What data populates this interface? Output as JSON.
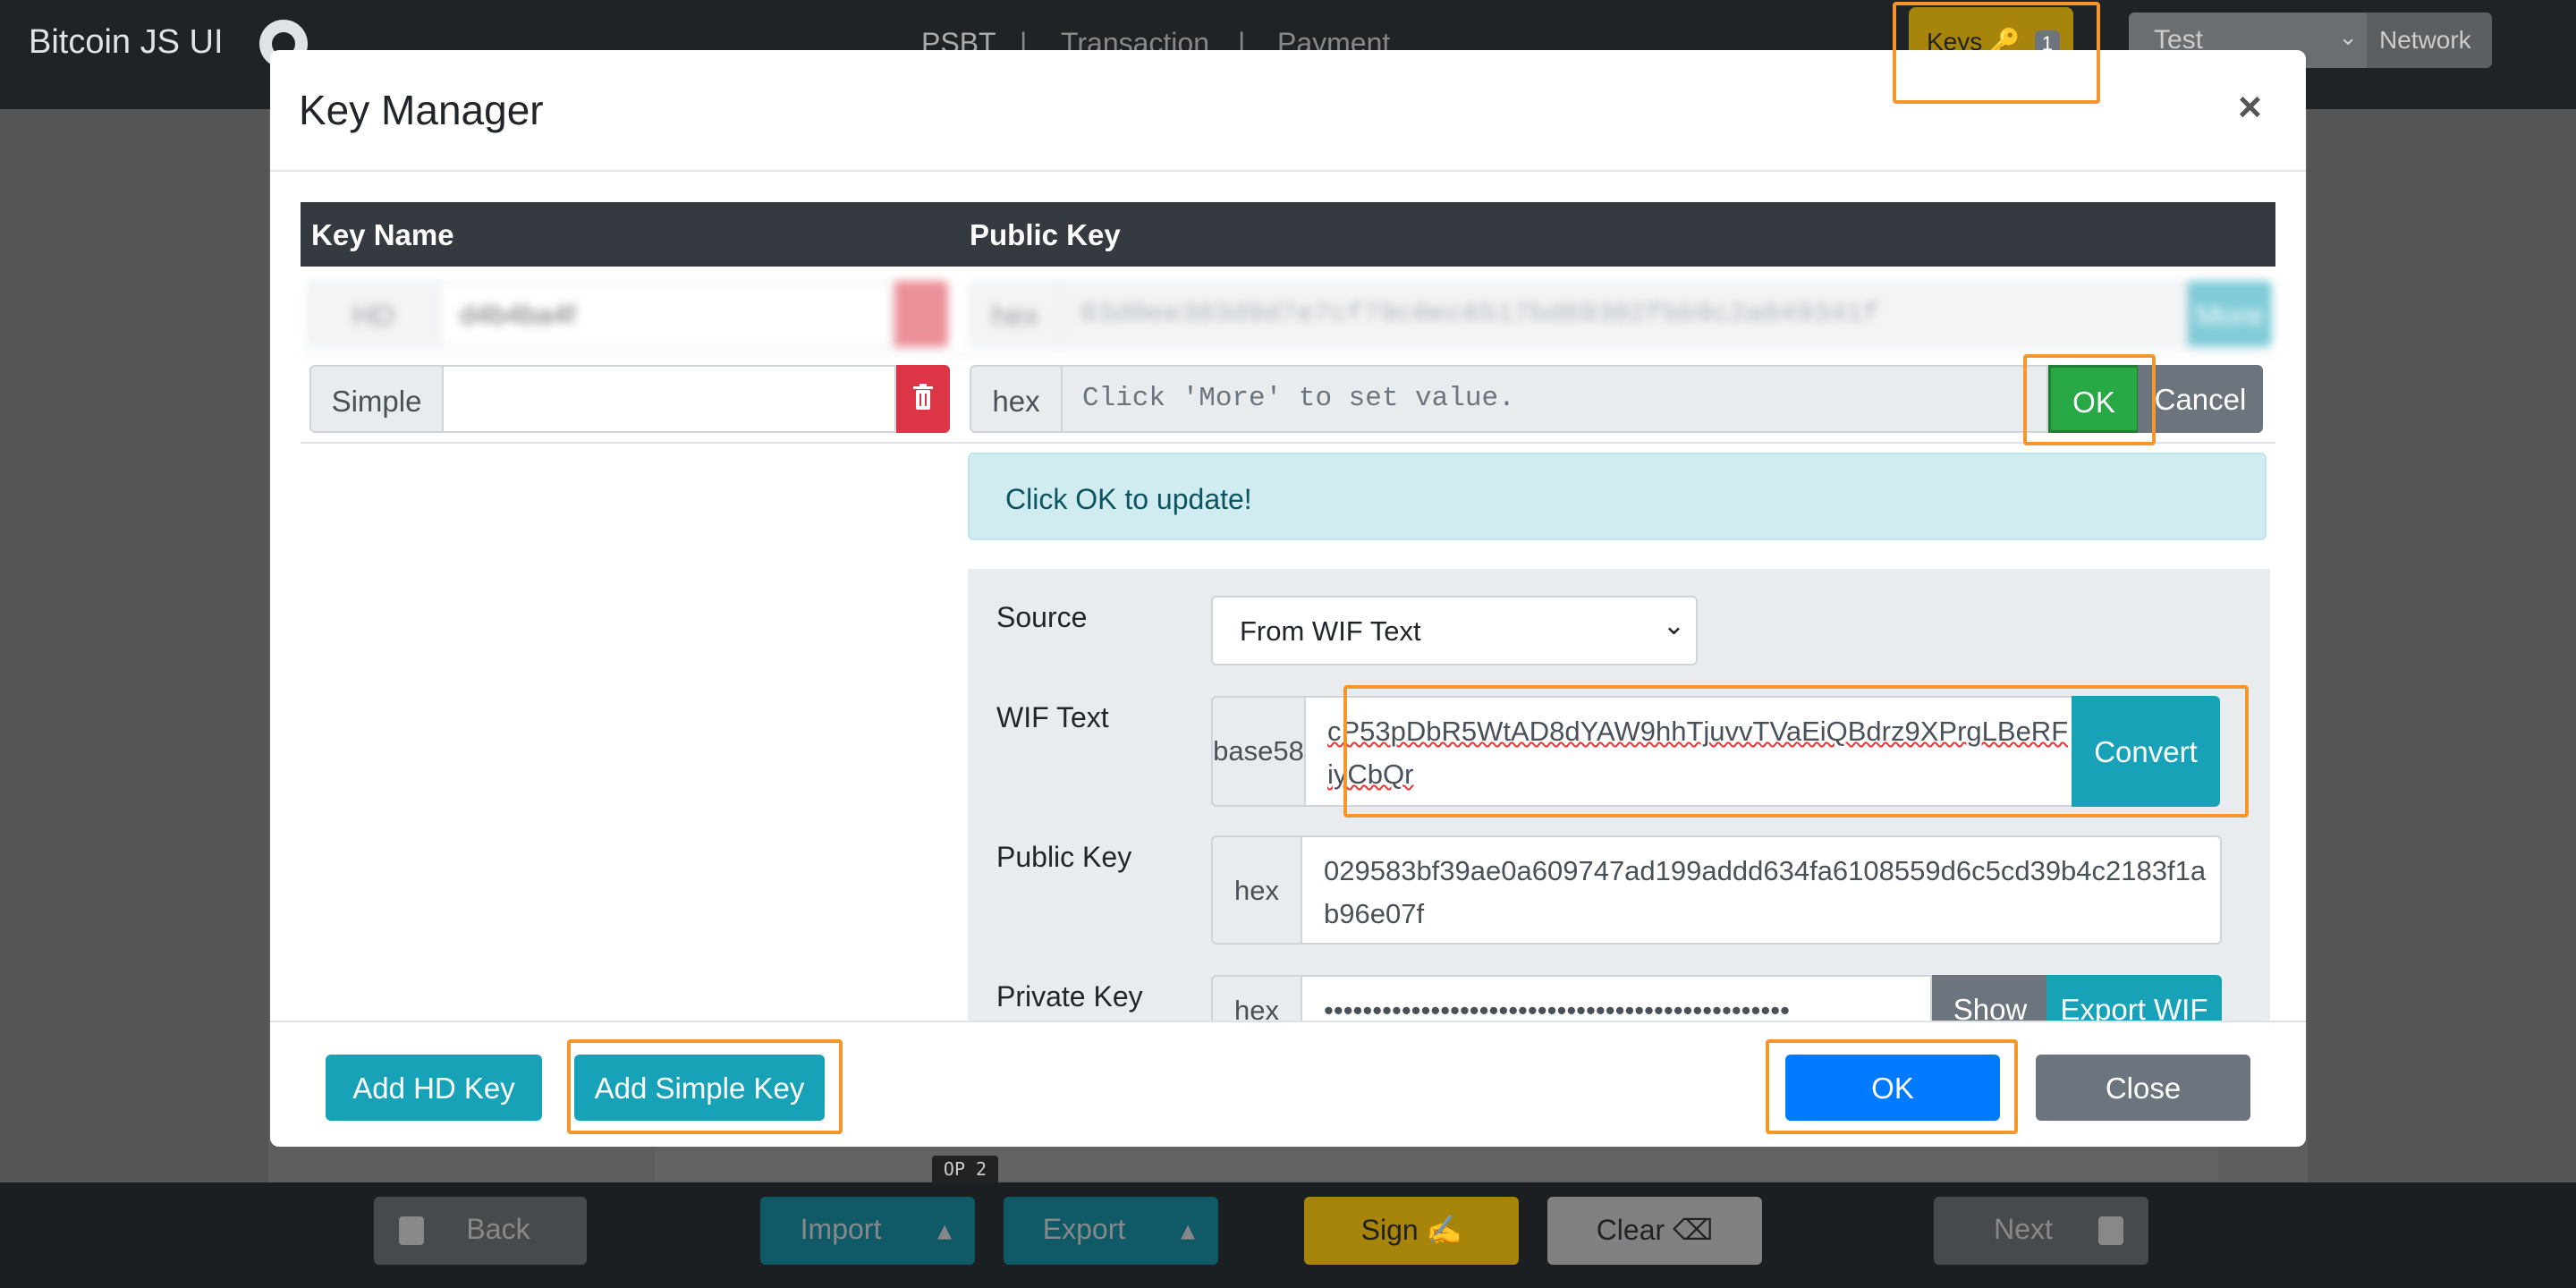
{
  "app": {
    "brand": "Bitcoin JS UI",
    "nav": [
      "PSBT",
      "|",
      "Transaction",
      "|",
      "Payment"
    ],
    "keys_label": "Keys",
    "keys_count": "1",
    "network_value": "Test",
    "network_button": "Network",
    "op_badge": "OP 2",
    "bottom": {
      "back": "Back",
      "import": "Import",
      "export": "Export",
      "sign": "Sign",
      "clear": "Clear",
      "next": "Next"
    }
  },
  "modal": {
    "title": "Key Manager",
    "close_symbol": "×",
    "table": {
      "headers": [
        "Key Name",
        "Public Key"
      ]
    },
    "row_blurred": {
      "type_label": "HD",
      "name_value": "d4b4ba4f",
      "encoding": "hex",
      "public_key": "03d0ee303d9d7e7cf79c0ec6517bd69302fbb9c2a049341f",
      "more": "More"
    },
    "row_simple": {
      "type_label": "Simple",
      "name_value": "",
      "encoding": "hex",
      "placeholder": "Click 'More' to set value.",
      "ok": "OK",
      "cancel": "Cancel"
    },
    "alert": "Click OK to update!",
    "form": {
      "source_label": "Source",
      "source_value": "From WIF Text",
      "wif_label": "WIF Text",
      "wif_addon": "base58",
      "wif_value": "cP53pDbR5WtAD8dYAW9hhTjuvvTVaEiQBdrz9XPrgLBeRFiyCbQr",
      "convert": "Convert",
      "pub_label": "Public Key",
      "pub_addon": "hex",
      "pub_value": "029583bf39ae0a609747ad199addd634fa6108559d6c5cd39b4c2183f1ab96e07f",
      "priv_label": "Private Key",
      "priv_addon": "hex",
      "priv_value": "••••••••••••••••••••••••••••••••••••••••••••••••",
      "show": "Show",
      "export_wif": "Export WIF"
    },
    "footer": {
      "add_hd": "Add HD Key",
      "add_simple": "Add Simple Key",
      "ok": "OK",
      "close": "Close"
    }
  },
  "colors": {
    "primary": "#007bff",
    "info": "#17a2b8",
    "success": "#28a745",
    "danger": "#dc3545",
    "secondary": "#6c757d",
    "highlight": "#f5962a"
  }
}
